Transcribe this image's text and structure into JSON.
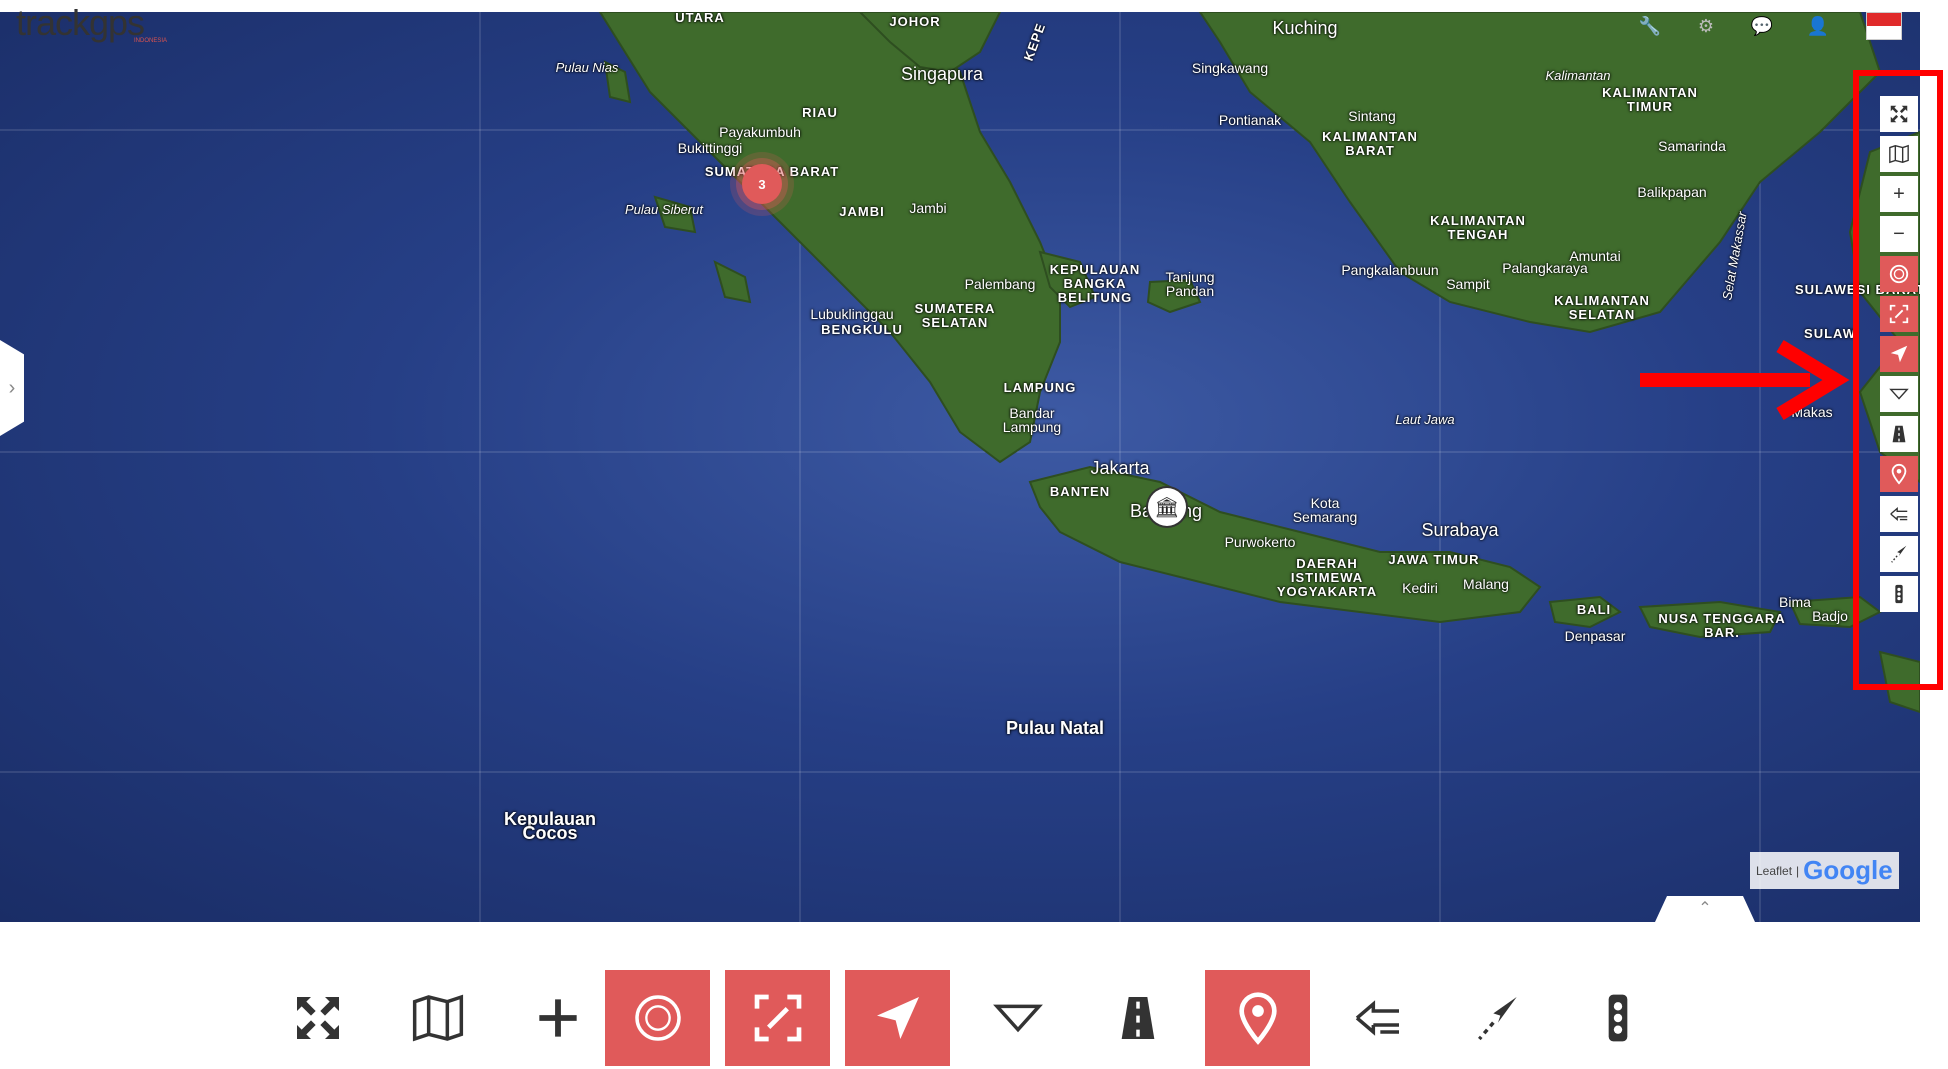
{
  "app": {
    "logo_text": "trackgps",
    "logo_sub": "INDONESIA"
  },
  "header_icons": [
    "wrench-icon",
    "gear-icon",
    "chat-icon",
    "user-icon",
    "flag-indonesia-icon"
  ],
  "map": {
    "cluster_count": "3",
    "labels": {
      "utara": "UTARA",
      "johor": "JOHOR",
      "kuching": "Kuching",
      "pulau_nias": "Pulau Nias",
      "singapura": "Singapura",
      "singkawang": "Singkawang",
      "kalimantan": "Kalimantan",
      "kaltim": "KALIMANTAN TIMUR",
      "riau": "RIAU",
      "payakumbuh": "Payakumbuh",
      "pontianak": "Pontianak",
      "sintang": "Sintang",
      "kalbar": "KALIMANTAN BARAT",
      "bukittinggi": "Bukittinggi",
      "sumbar": "SUMATERA BARAT",
      "samarinda": "Samarinda",
      "balikpapan": "Balikpapan",
      "pulau_siberut": "Pulau Siberut",
      "jambi_prov": "JAMBI",
      "jambi": "Jambi",
      "kalteng": "KALIMANTAN TENGAH",
      "selat_makassar": "Selat Makassar",
      "palembang": "Palembang",
      "babel": "KEPULAUAN BANGKA BELITUNG",
      "tanjung_pandan": "Tanjung Pandan",
      "pangkalanbuun": "Pangkalanbuun",
      "palangkaraya": "Palangkaraya",
      "amuntai": "Amuntai",
      "sampit": "Sampit",
      "sulbar": "SULAWESI BARAT",
      "lubuklinggau": "Lubuklinggau",
      "bengkulu": "BENGKULU",
      "sumsel": "SUMATERA SELATAN",
      "kalsel": "KALIMANTAN SELATAN",
      "lampung": "LAMPUNG",
      "bandar_lampung": "Bandar Lampung",
      "laut_jawa": "Laut Jawa",
      "jakarta": "Jakarta",
      "banten": "BANTEN",
      "bandung": "Bandung",
      "kota_semarang": "Kota Semarang",
      "surabaya": "Surabaya",
      "purwokerto": "Purwokerto",
      "jatim": "JAWA TIMUR",
      "diy": "DAERAH ISTIMEWA YOGYAKARTA",
      "kediri": "Kediri",
      "malang": "Malang",
      "bali": "BALI",
      "denpasar": "Denpasar",
      "bima": "Bima",
      "ntb": "NUSA TENGGARA BAR.",
      "pulau_natal": "Pulau Natal",
      "cocos": "Kepulauan Cocos",
      "kepe": "KEPE",
      "makassar_partial": "Makas",
      "sulawesi_partial": "SULAW",
      "badjo": "Badjo"
    }
  },
  "attribution": {
    "leaflet": "Leaflet",
    "google": "Google"
  },
  "controls": [
    "fullscreen-icon",
    "map-layers-icon",
    "zoom-in-icon",
    "zoom-out-icon",
    "cluster-icon",
    "fit-bounds-icon",
    "navigate-icon",
    "measure-icon",
    "road-icon",
    "marker-icon",
    "history-icon",
    "route-icon",
    "traffic-light-icon"
  ],
  "colors": {
    "accent": "#e05a5a",
    "highlight": "#ff0000"
  }
}
